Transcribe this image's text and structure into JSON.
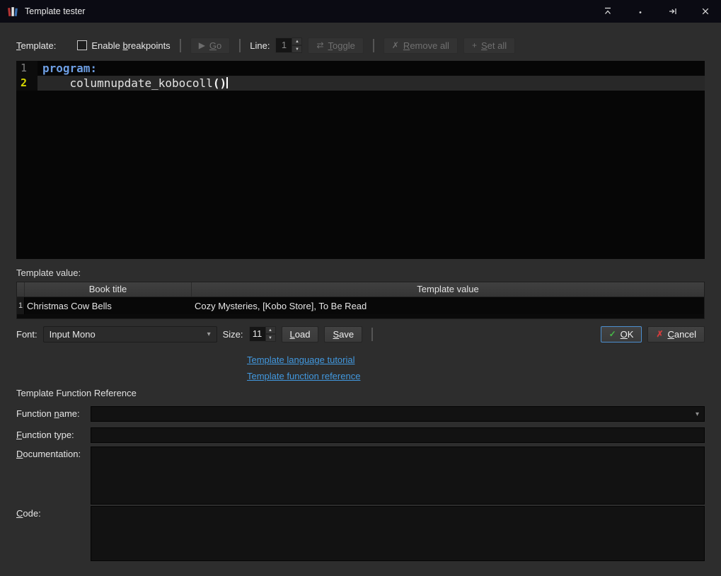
{
  "window": {
    "title": "Template tester"
  },
  "toolbar": {
    "template_label": {
      "accel": "T",
      "post": "emplate:"
    },
    "breakpoints": {
      "pre": "Enable ",
      "accel": "b",
      "post": "reakpoints"
    },
    "go": {
      "icon": "▶",
      "accel": "G",
      "post": "o"
    },
    "line_label": "Line:",
    "line_value": "1",
    "toggle": {
      "icon": "⇄",
      "accel": "T",
      "post": "oggle"
    },
    "remove_all": {
      "icon": "✗",
      "accel": "R",
      "post": "emove all"
    },
    "set_all": {
      "icon": "+",
      "accel": "S",
      "post": "et all"
    }
  },
  "editor": {
    "lines": [
      {
        "num": "1",
        "keyword": "program:"
      },
      {
        "num": "2",
        "indent": "    ",
        "text": "columnupdate_kobocoll",
        "parens": "()"
      }
    ]
  },
  "results": {
    "label": "Template value:",
    "headers": {
      "book_title": "Book title",
      "template_value": "Template value"
    },
    "rows": [
      {
        "index": "1",
        "title": "Christmas Cow Bells",
        "value": "Cozy Mysteries, [Kobo Store], To Be Read"
      }
    ]
  },
  "font_row": {
    "font_label": "Font:",
    "font_value": "Input Mono",
    "size_label": "Size:",
    "size_value": "11",
    "load": {
      "accel": "L",
      "post": "oad"
    },
    "save": {
      "accel": "S",
      "post": "ave"
    },
    "ok": {
      "icon": "✓",
      "accel": "O",
      "post": "K"
    },
    "cancel": {
      "icon": "✗",
      "accel": "C",
      "post": "ancel"
    }
  },
  "links": {
    "tutorial": "Template language tutorial",
    "reference": "Template function reference"
  },
  "function_ref": {
    "title": "Template Function Reference",
    "name_label": {
      "pre": "Function ",
      "accel": "n",
      "post": "ame:"
    },
    "type_label": {
      "accel": "F",
      "post": "unction type:"
    },
    "doc_label": {
      "accel": "D",
      "post": "ocumentation:"
    },
    "code_label": {
      "accel": "C",
      "post": "ode:"
    }
  },
  "icons": {
    "combo_arrow": "▾",
    "spin_up": "▲",
    "spin_down": "▼"
  },
  "colors": {
    "accent_link": "#4299e0",
    "ok_border": "#4c8fd0",
    "keyword_blue": "#6d9ee3",
    "current_line_number": "#d6d600"
  }
}
